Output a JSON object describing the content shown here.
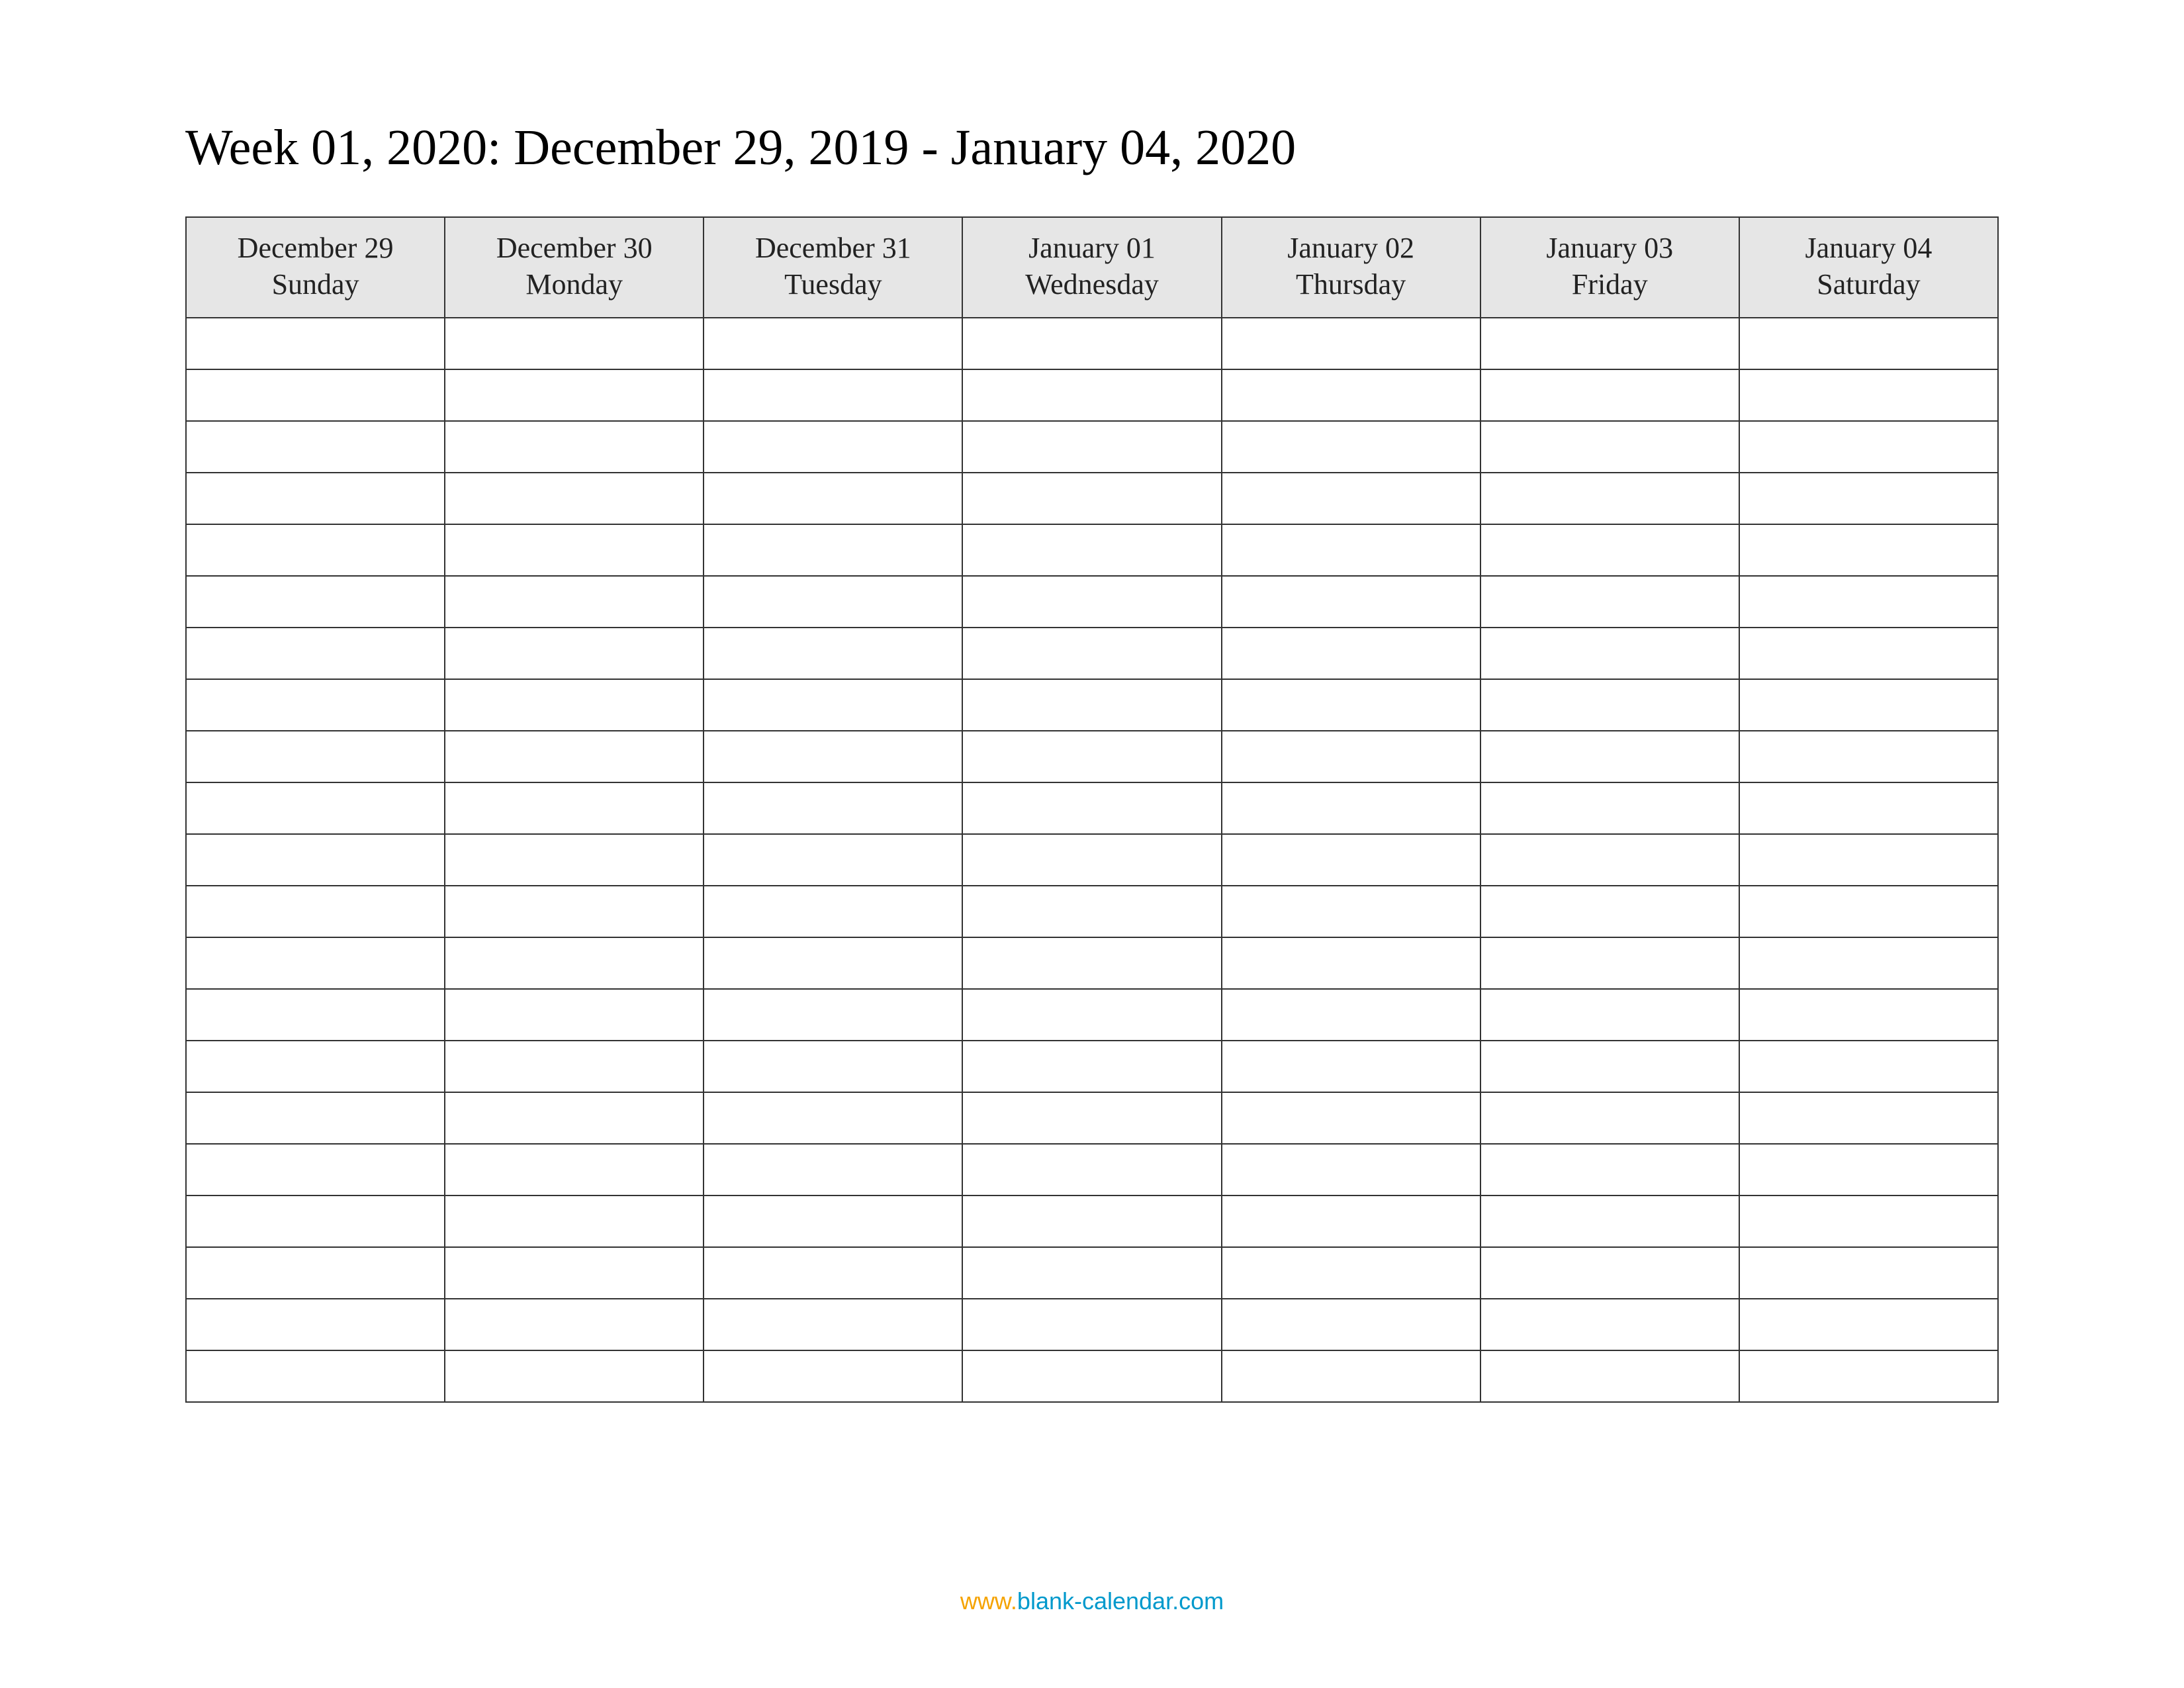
{
  "title": "Week 01, 2020: December 29, 2019 - January 04, 2020",
  "days": [
    {
      "date": "December 29",
      "weekday": "Sunday"
    },
    {
      "date": "December 30",
      "weekday": "Monday"
    },
    {
      "date": "December 31",
      "weekday": "Tuesday"
    },
    {
      "date": "January 01",
      "weekday": "Wednesday"
    },
    {
      "date": "January 02",
      "weekday": "Thursday"
    },
    {
      "date": "January 03",
      "weekday": "Friday"
    },
    {
      "date": "January 04",
      "weekday": "Saturday"
    }
  ],
  "rowCount": 21,
  "footer": {
    "prefix": "www.",
    "domain": "blank-calendar.com"
  }
}
